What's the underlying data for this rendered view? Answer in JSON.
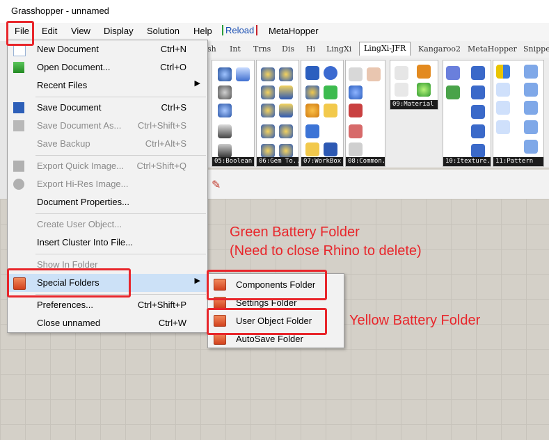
{
  "window": {
    "title": "Grasshopper - unnamed"
  },
  "menubar": {
    "items": [
      "File",
      "Edit",
      "View",
      "Display",
      "Solution",
      "Help"
    ],
    "reload_label": "Reload",
    "metahopper_label": "MetaHopper"
  },
  "tabs": [
    "sh",
    "Int",
    "Trns",
    "Dis",
    "Hi",
    "LingXi",
    "LingXi-JFR",
    "Kangaroo2",
    "MetaHopper",
    "Snippe"
  ],
  "ribbon_groups": [
    "05:Boolean",
    "06:Gem To...",
    "07:WorkBox",
    "08:Common...",
    "09:Material",
    "10:Itexture...",
    "11:Pattern"
  ],
  "file_menu": {
    "items": [
      {
        "label": "New Document",
        "shortcut": "Ctrl+N"
      },
      {
        "label": "Open Document...",
        "shortcut": "Ctrl+O"
      },
      {
        "label": "Recent Files",
        "shortcut": ""
      },
      {
        "label": "Save Document",
        "shortcut": "Ctrl+S"
      },
      {
        "label": "Save Document As...",
        "shortcut": "Ctrl+Shift+S"
      },
      {
        "label": "Save Backup",
        "shortcut": "Ctrl+Alt+S"
      },
      {
        "label": "Export Quick Image...",
        "shortcut": "Ctrl+Shift+Q"
      },
      {
        "label": "Export Hi-Res Image...",
        "shortcut": ""
      },
      {
        "label": "Document Properties...",
        "shortcut": ""
      },
      {
        "label": "Create User Object...",
        "shortcut": ""
      },
      {
        "label": "Insert Cluster Into File...",
        "shortcut": ""
      },
      {
        "label": "Show In Folder",
        "shortcut": ""
      },
      {
        "label": "Special Folders",
        "shortcut": ""
      },
      {
        "label": "Preferences...",
        "shortcut": "Ctrl+Shift+P"
      },
      {
        "label": "Close unnamed",
        "shortcut": "Ctrl+W"
      }
    ]
  },
  "special_folders_menu": {
    "items": [
      "Components Folder",
      "Settings Folder",
      "User Object Folder",
      "AutoSave Folder"
    ]
  },
  "annotations": {
    "green_title": "Green Battery Folder",
    "green_note": "(Need to close Rhino to delete)",
    "yellow_title": "Yellow Battery Folder"
  },
  "colors": {
    "highlight_red": "#e8262b",
    "menu_highlight": "#cce1f7",
    "canvas": "#d4d0c8"
  }
}
